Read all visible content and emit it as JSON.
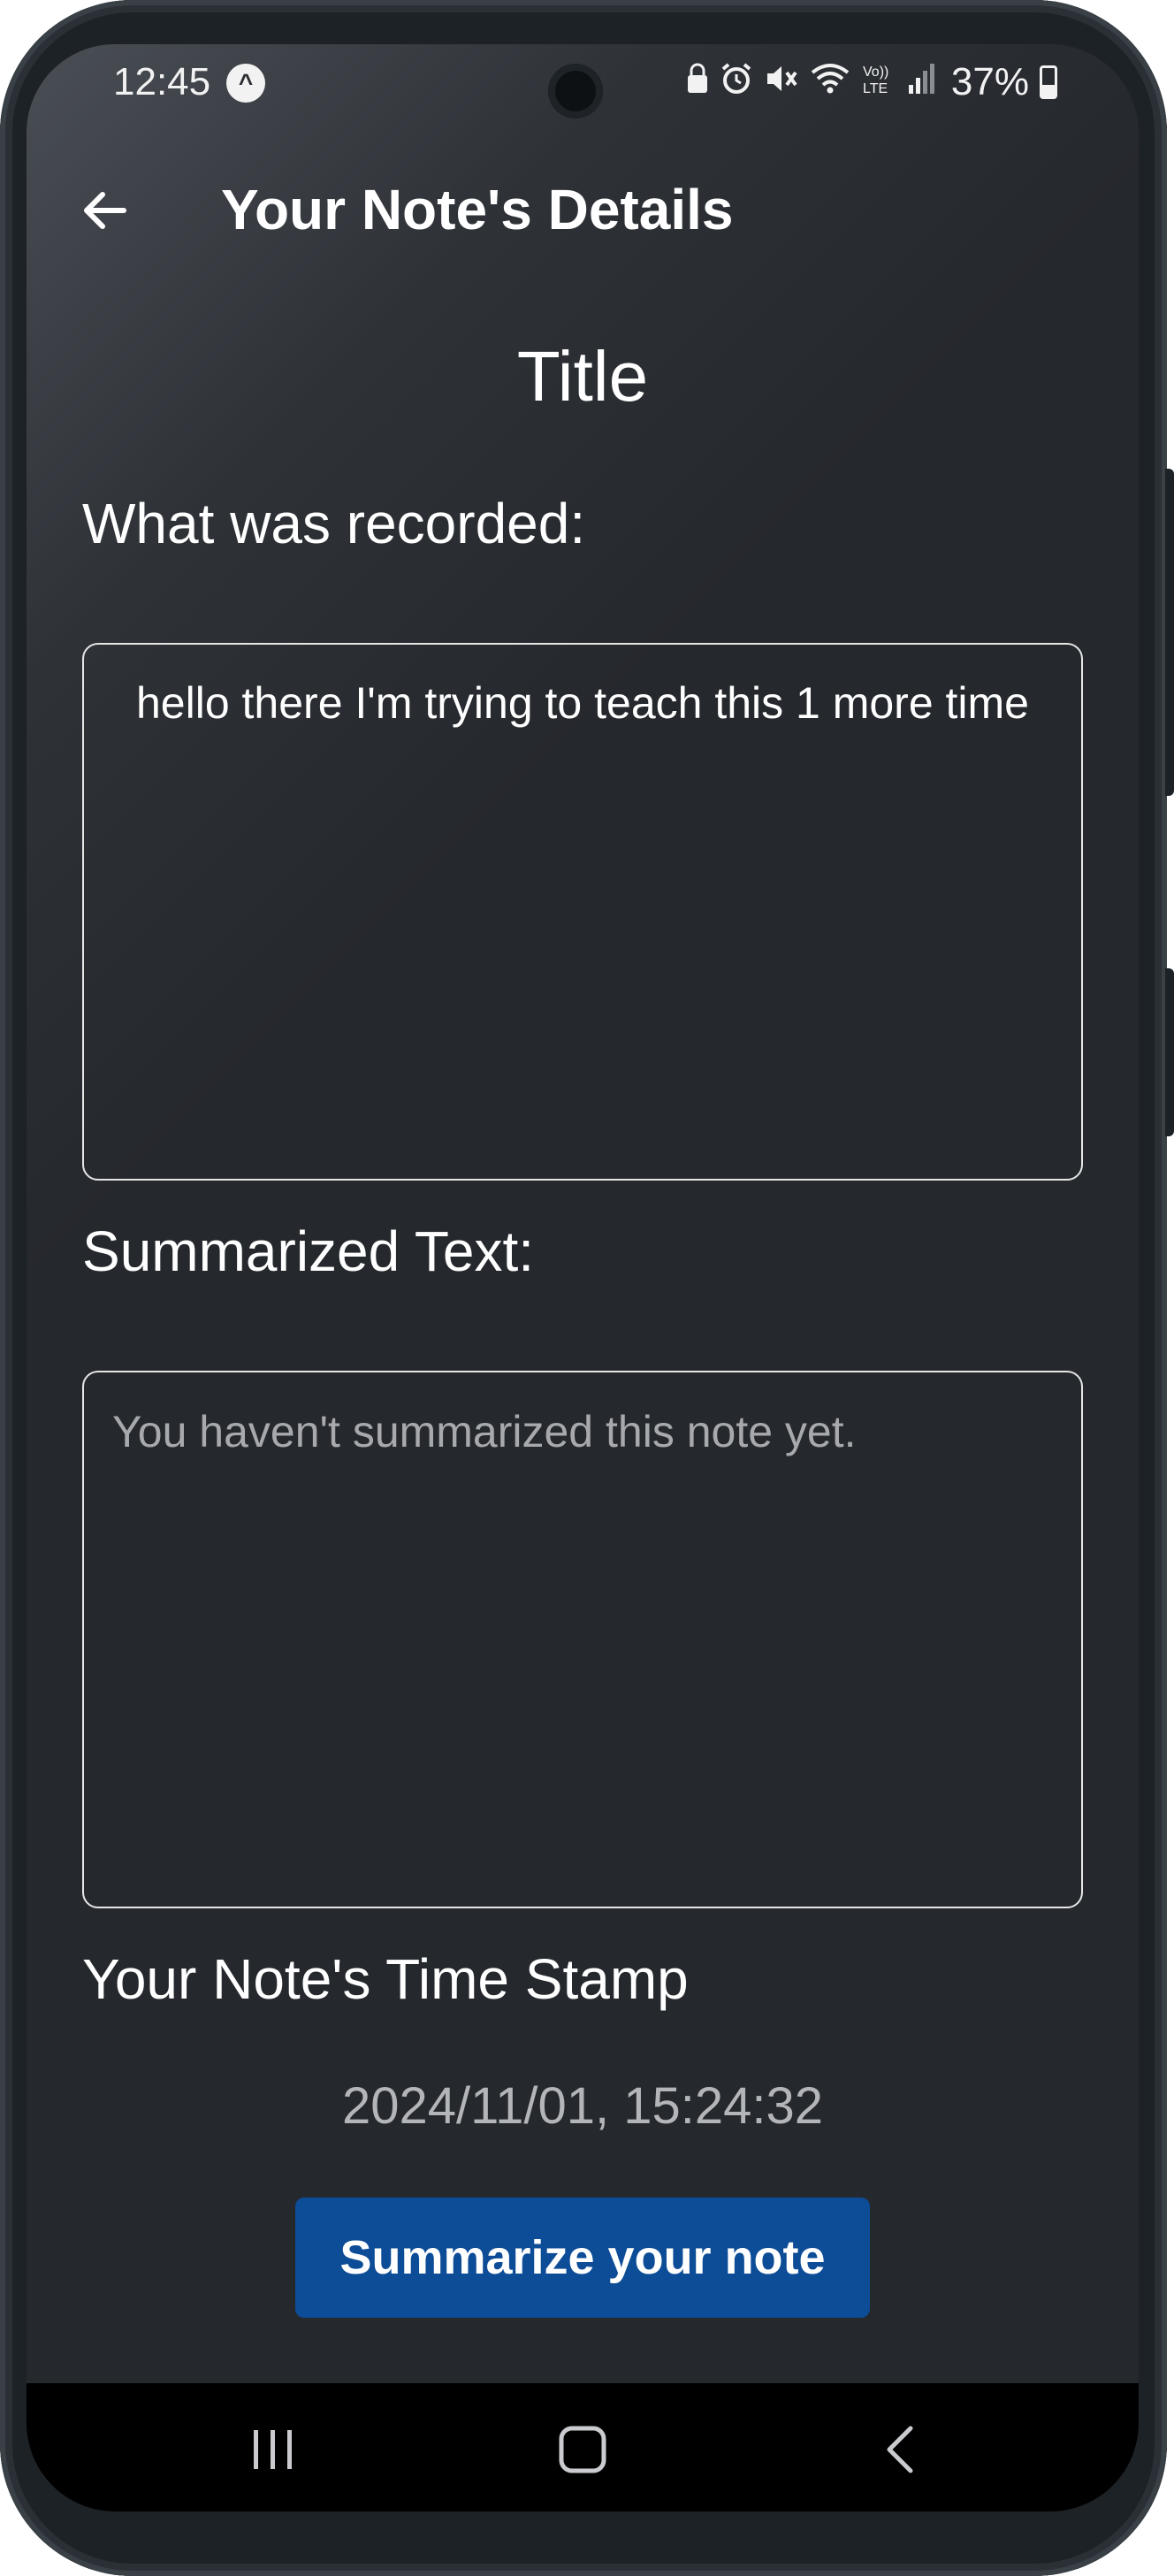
{
  "status_bar": {
    "time": "12:45",
    "battery_percent": "37%",
    "icons": [
      "app-notification-icon",
      "lock-icon",
      "alarm-icon",
      "mute-icon",
      "wifi-icon",
      "volte-icon",
      "signal-icon",
      "battery-icon"
    ]
  },
  "app_bar": {
    "title": "Your Note's Details",
    "back_icon": "arrow-left-icon"
  },
  "note": {
    "title": "Title",
    "recorded_label": "What was recorded:",
    "recorded_text": "hello there I'm trying to teach this 1 more time",
    "summary_label": "Summarized Text:",
    "summary_placeholder": "You haven't summarized this note yet.",
    "timestamp_label": "Your Note's Time Stamp",
    "timestamp_value": "2024/11/01, 15:24:32"
  },
  "actions": {
    "summarize_label": "Summarize your note"
  },
  "nav_bar": {
    "icons": [
      "recents-icon",
      "home-icon",
      "back-icon"
    ]
  },
  "colors": {
    "background": "#25282d",
    "button": "#0d4c96",
    "text": "#ffffff",
    "muted_text": "#a7a9ad"
  }
}
